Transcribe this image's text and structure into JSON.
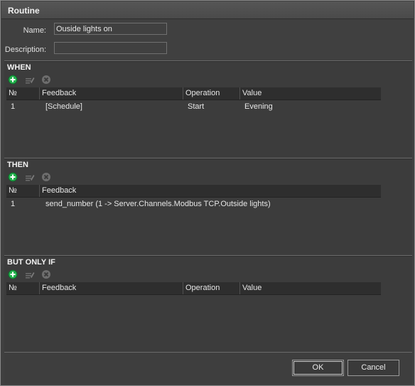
{
  "window": {
    "title": "Routine"
  },
  "form": {
    "name_label": "Name:",
    "name_value": "Ouside lights on",
    "description_label": "Description:",
    "description_value": ""
  },
  "toolbar_icons": [
    "add-icon",
    "edit-icon",
    "delete-icon"
  ],
  "when": {
    "title": "WHEN",
    "columns": [
      "№",
      "Feedback",
      "Operation",
      "Value"
    ],
    "rows": [
      {
        "num": "1",
        "feedback": "[Schedule]",
        "operation": "Start",
        "value": "Evening"
      }
    ]
  },
  "then": {
    "title": "THEN",
    "columns": [
      "№",
      "Feedback"
    ],
    "rows": [
      {
        "num": "1",
        "feedback": "send_number (1 -> Server.Channels.Modbus TCP.Outside lights)"
      }
    ]
  },
  "only_if": {
    "title": "BUT ONLY IF",
    "columns": [
      "№",
      "Feedback",
      "Operation",
      "Value"
    ],
    "rows": []
  },
  "buttons": {
    "ok": "OK",
    "cancel": "Cancel"
  },
  "colors": {
    "add": "#22b14c",
    "background": "#404040",
    "header": "#2e2e2e"
  }
}
